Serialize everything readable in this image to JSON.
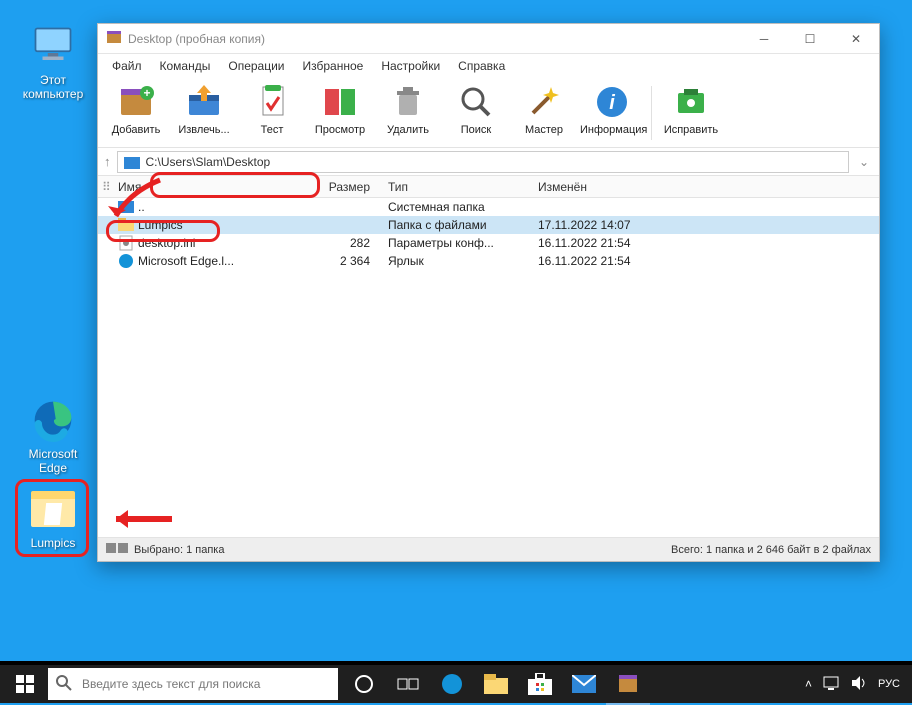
{
  "desktop": {
    "this_pc": "Этот\nкомпьютер",
    "edge": "Microsoft\nEdge",
    "lumpics": "Lumpics"
  },
  "taskbar": {
    "search_placeholder": "Введите здесь текст для поиска"
  },
  "window": {
    "title": "Desktop (пробная копия)",
    "menu": [
      "Файл",
      "Команды",
      "Операции",
      "Избранное",
      "Настройки",
      "Справка"
    ],
    "tools": {
      "add": "Добавить",
      "extract": "Извлечь...",
      "test": "Тест",
      "view": "Просмотр",
      "delete": "Удалить",
      "find": "Поиск",
      "wizard": "Мастер",
      "info": "Информация",
      "repair": "Исправить"
    },
    "path": "C:\\Users\\Slam\\Desktop",
    "columns": {
      "name": "Имя",
      "size": "Размер",
      "type": "Тип",
      "date": "Изменён"
    },
    "rows": [
      {
        "name": "..",
        "size": "",
        "type": "Системная папка",
        "date": ""
      },
      {
        "name": "Lumpics",
        "size": "",
        "type": "Папка с файлами",
        "date": "17.11.2022 14:07"
      },
      {
        "name": "desktop.ini",
        "size": "282",
        "type": "Параметры конф...",
        "date": "16.11.2022 21:54"
      },
      {
        "name": "Microsoft Edge.l...",
        "size": "2 364",
        "type": "Ярлык",
        "date": "16.11.2022 21:54"
      }
    ],
    "status_left": "Выбрано: 1 папка",
    "status_right": "Всего: 1 папка и 2 646 байт в 2 файлах"
  }
}
